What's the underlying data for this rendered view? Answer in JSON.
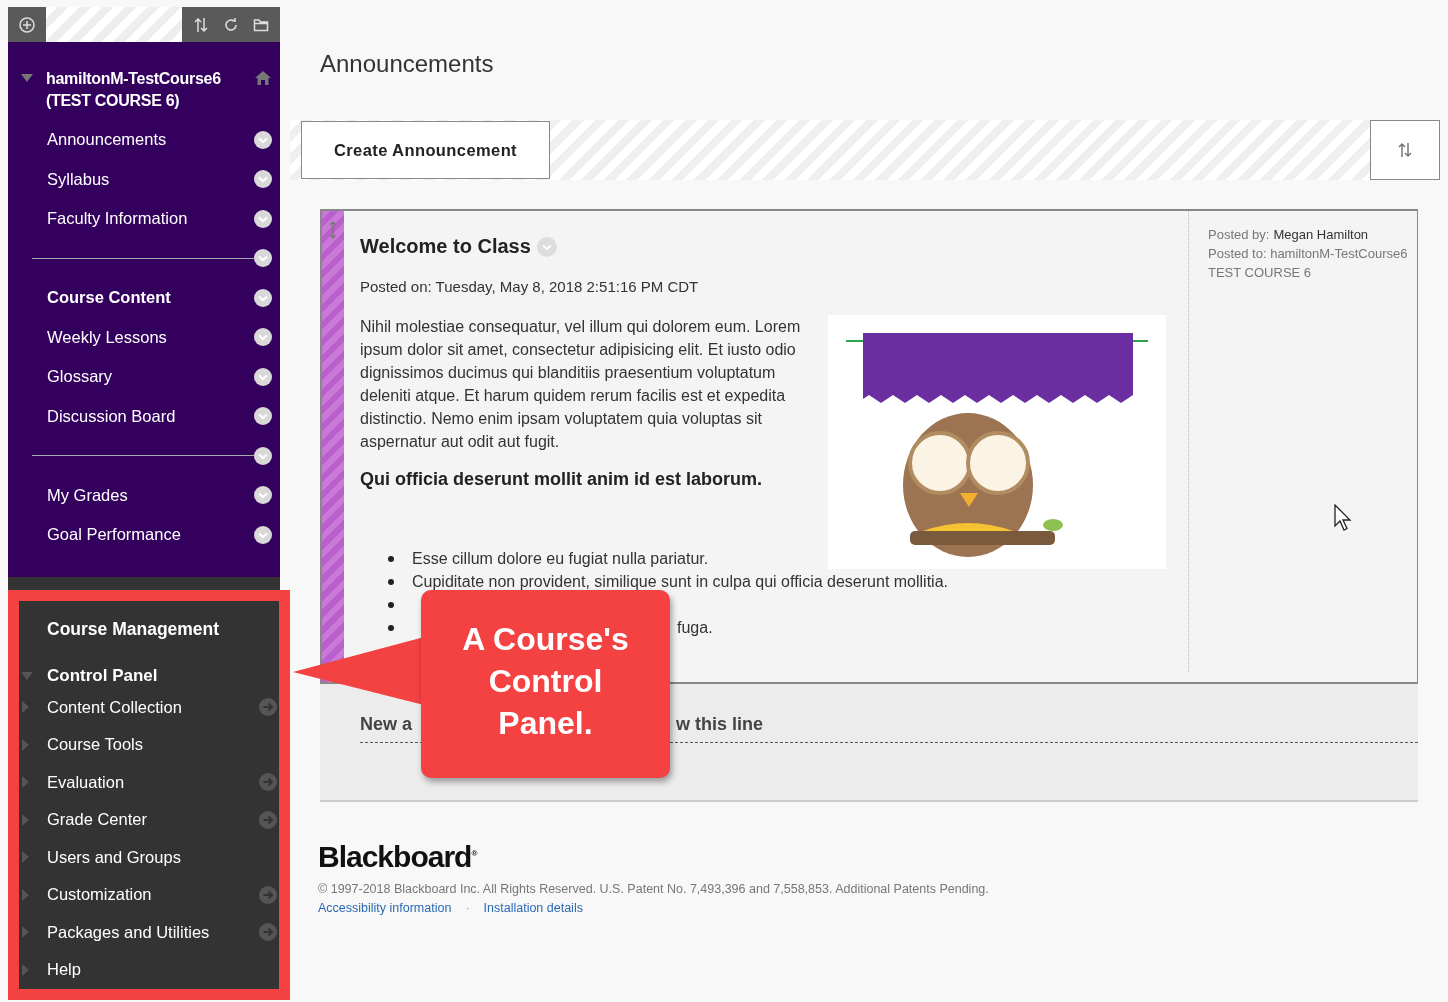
{
  "course": {
    "title": "hamiltonM-TestCourse6 (TEST COURSE 6)",
    "expanded": true
  },
  "course_menu": [
    {
      "kind": "link",
      "label": "Announcements"
    },
    {
      "kind": "link",
      "label": "Syllabus"
    },
    {
      "kind": "link",
      "label": "Faculty Information"
    },
    {
      "kind": "divider"
    },
    {
      "kind": "heading",
      "label": "Course Content"
    },
    {
      "kind": "link",
      "label": "Weekly Lessons"
    },
    {
      "kind": "link",
      "label": "Glossary"
    },
    {
      "kind": "link",
      "label": "Discussion Board"
    },
    {
      "kind": "divider"
    },
    {
      "kind": "link",
      "label": "My Grades"
    },
    {
      "kind": "link",
      "label": "Goal Performance"
    }
  ],
  "management": {
    "title": "Course Management",
    "control_panel": {
      "label": "Control Panel",
      "expanded": true
    },
    "items": [
      {
        "label": "Content Collection",
        "expanded": false,
        "kind": "arrow"
      },
      {
        "label": "Course Tools",
        "expanded": false,
        "kind": "plain"
      },
      {
        "label": "Evaluation",
        "expanded": false,
        "kind": "arrow"
      },
      {
        "label": "Grade Center",
        "expanded": false,
        "kind": "arrow"
      },
      {
        "label": "Users and Groups",
        "expanded": false,
        "kind": "plain"
      },
      {
        "label": "Customization",
        "expanded": false,
        "kind": "arrow"
      },
      {
        "label": "Packages and Utilities",
        "expanded": false,
        "kind": "arrow"
      },
      {
        "label": "Help",
        "expanded": false,
        "kind": "plain"
      }
    ]
  },
  "page_title": "Announcements",
  "actions": {
    "create": "Create Announcement"
  },
  "announcement": {
    "title": "Welcome to Class",
    "posted_on": "Posted on: Tuesday, May 8, 2018 2:51:16 PM CDT",
    "paragraph": "Nihil molestiae consequatur, vel illum qui dolorem eum. Lorem ipsum dolor sit amet, consectetur adipisicing elit. Et iusto odio dignissimos ducimus qui blanditiis praesentium voluptatum deleniti atque. Et harum quidem rerum facilis est et expedita distinctio. Nemo enim ipsam voluptatem quia voluptas sit aspernatur aut odit aut fugit.",
    "heading": "Qui officia deserunt mollit anim id est laborum.",
    "bullets": [
      {
        "text": "Esse cillum dolore eu fugiat nulla pariatur.",
        "covered": false
      },
      {
        "text": "Cupiditate non provident, similique sunt in culpa qui officia deserunt mollitia.",
        "covered": false
      },
      {
        "covered": true
      },
      {
        "text": "fuga.",
        "covered": true
      }
    ],
    "posted_by_label": "Posted by:",
    "posted_by": "Megan Hamilton",
    "posted_to": "Posted to: hamiltonM-TestCourse6 TEST COURSE 6"
  },
  "separator": {
    "left": "New a",
    "right": "w this line"
  },
  "footer": {
    "logo": "Blackboard$^{®}$",
    "copyright": "© 1997-2018 Blackboard Inc. All Rights Reserved. U.S. Patent No. 7,493,396 and 7,558,853. Additional Patents Pending.",
    "links": [
      "Accessibility information",
      "Installation details"
    ],
    "link_separator": "·"
  },
  "callout": {
    "text": "A Course's Control Panel."
  }
}
